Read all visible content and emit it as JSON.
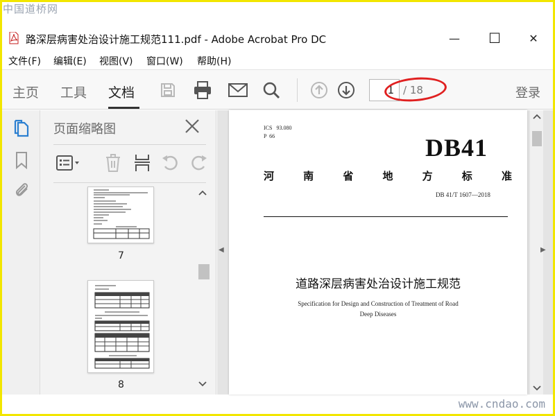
{
  "watermark": {
    "top": "中国道桥网",
    "bottom": "www.cndao.com"
  },
  "window": {
    "title": "路深层病害处治设计施工规范111.pdf - Adobe Acrobat Pro DC",
    "minimize": "—",
    "maximize": "☐",
    "close": "✕"
  },
  "menu": [
    "文件(F)",
    "编辑(E)",
    "视图(V)",
    "窗口(W)",
    "帮助(H)"
  ],
  "toolbar": {
    "tabs": [
      "主页",
      "工具",
      "文档"
    ],
    "active_tab": "文档",
    "page_current": "1",
    "page_total": "/ 18",
    "login": "登录",
    "icons": [
      "save-icon",
      "print-icon",
      "email-icon",
      "search-icon",
      "page-up-icon",
      "page-down-icon"
    ]
  },
  "side_rail": {
    "icons": [
      "page-thumbnails-icon",
      "bookmark-icon",
      "attachment-icon"
    ]
  },
  "thumbnail_panel": {
    "title": "页面缩略图",
    "tools": [
      "thumbnail-options-icon",
      "delete-icon",
      "insert-page-icon",
      "undo-icon",
      "redo-icon"
    ],
    "pages": [
      {
        "label": "7"
      },
      {
        "label": "8"
      }
    ]
  },
  "document": {
    "ics_line1": "ICS   93.080",
    "ics_line2": "P  66",
    "code": "DB41",
    "standard_chars": [
      "河",
      "南",
      "省",
      "地",
      "方",
      "标",
      "准"
    ],
    "standard_number": "DB 41/T  1607—2018",
    "title_cn": "道路深层病害处治设计施工规范",
    "title_en_line1": "Specification for Design and Construction of Treatment of Road",
    "title_en_line2": "Deep Diseases"
  },
  "colors": {
    "highlight": "#e02020",
    "frame": "#f2e600"
  }
}
